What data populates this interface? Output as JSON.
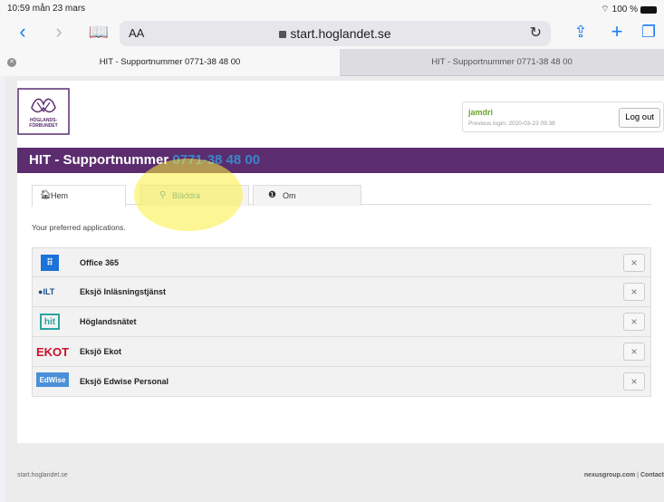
{
  "status_bar": {
    "time_date": "10:59  mån 23 mars",
    "battery": "100 %"
  },
  "toolbar": {
    "aa_label": "AA",
    "url": "start.hoglandet.se"
  },
  "browser_tabs": [
    {
      "title": "HIT - Supportnummer 0771-38 48 00",
      "active": true
    },
    {
      "title": "HIT - Supportnummer 0771-38 48 00",
      "active": false
    }
  ],
  "logo": {
    "text": "HÖGLANDS-\nFÖRBUNDET"
  },
  "user": {
    "name": "jamdri",
    "last_login": "Previous login: 2020-03-23 09:38",
    "logout_label": "Log out"
  },
  "banner": {
    "title": "HIT - Supportnummer ",
    "phone": "0771-38 48 00"
  },
  "tabs": [
    {
      "label": "Hem",
      "icon": "home-icon"
    },
    {
      "label": "Bläddra",
      "icon": "search-icon"
    },
    {
      "label": "Om",
      "icon": "info-icon"
    }
  ],
  "preferred_text": "Your preferred applications.",
  "apps": [
    {
      "label": "Office 365",
      "icon_text": "⠿",
      "icon_color": "#1b72d8"
    },
    {
      "label": "Eksjö Inläsningstjänst",
      "icon_text": "ILT",
      "icon_color": "#1a4f8c"
    },
    {
      "label": "Höglandsnätet",
      "icon_text": "hit",
      "icon_color": "#2aa3a0"
    },
    {
      "label": "Eksjö Ekot",
      "icon_text": "EKOT",
      "icon_color": "#c8102e"
    },
    {
      "label": "Eksjö Edwise Personal",
      "icon_text": "EdWise",
      "icon_color": "#4a90d9"
    }
  ],
  "remove_label": "×",
  "footer": {
    "left": "start.hoglandet.se",
    "right_link": "nexusgroup.com",
    "separator": " | ",
    "right_contact": "Contact"
  },
  "colors": {
    "banner": "#5b2d6f",
    "phone": "#3a86c9",
    "safari_blue": "#1a7cf5",
    "username": "#6aa32a"
  }
}
